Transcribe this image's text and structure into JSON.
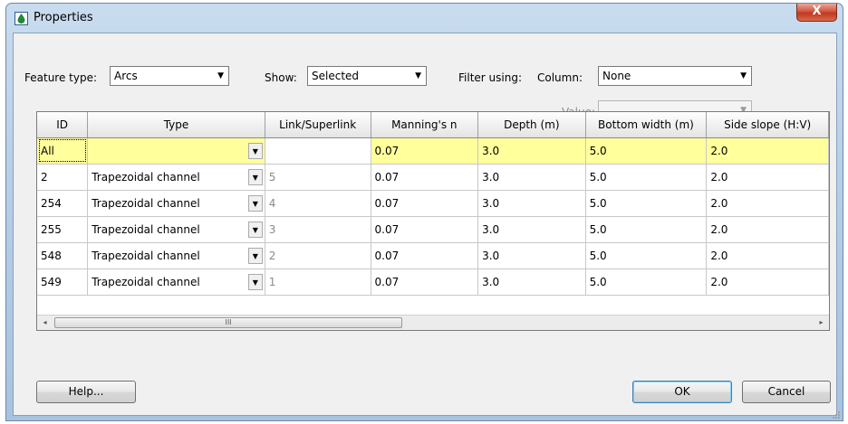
{
  "window": {
    "title": "Properties",
    "close_label": "X"
  },
  "filters": {
    "feature_type_label": "Feature type:",
    "feature_type_value": "Arcs",
    "show_label": "Show:",
    "show_value": "Selected",
    "filter_using_label": "Filter using:",
    "column_label": "Column:",
    "column_value": "None",
    "value_label": "Value:",
    "value_value": ""
  },
  "grid": {
    "headers": [
      "ID",
      "Type",
      "Link/Superlink",
      "Manning's n",
      "Depth (m)",
      "Bottom width (m)",
      "Side slope (H:V)"
    ],
    "rows": [
      {
        "id": "All",
        "type": "",
        "link": "",
        "manning": "0.07",
        "depth": "3.0",
        "bottom": "5.0",
        "slope": "2.0"
      },
      {
        "id": "2",
        "type": "Trapezoidal channel",
        "link": "5",
        "manning": "0.07",
        "depth": "3.0",
        "bottom": "5.0",
        "slope": "2.0"
      },
      {
        "id": "254",
        "type": "Trapezoidal channel",
        "link": "4",
        "manning": "0.07",
        "depth": "3.0",
        "bottom": "5.0",
        "slope": "2.0"
      },
      {
        "id": "255",
        "type": "Trapezoidal channel",
        "link": "3",
        "manning": "0.07",
        "depth": "3.0",
        "bottom": "5.0",
        "slope": "2.0"
      },
      {
        "id": "548",
        "type": "Trapezoidal channel",
        "link": "2",
        "manning": "0.07",
        "depth": "3.0",
        "bottom": "5.0",
        "slope": "2.0"
      },
      {
        "id": "549",
        "type": "Trapezoidal channel",
        "link": "1",
        "manning": "0.07",
        "depth": "3.0",
        "bottom": "5.0",
        "slope": "2.0"
      }
    ],
    "scroll_left": "◂",
    "scroll_right": "▸",
    "scroll_thumb": "III"
  },
  "buttons": {
    "help": "Help...",
    "ok": "OK",
    "cancel": "Cancel"
  },
  "icons": {
    "dropdown": "chevron-down-icon",
    "app": "water-drop-icon"
  },
  "colors": {
    "highlight_row": "#ffff9c",
    "window_frame": "#b7cfe8"
  }
}
